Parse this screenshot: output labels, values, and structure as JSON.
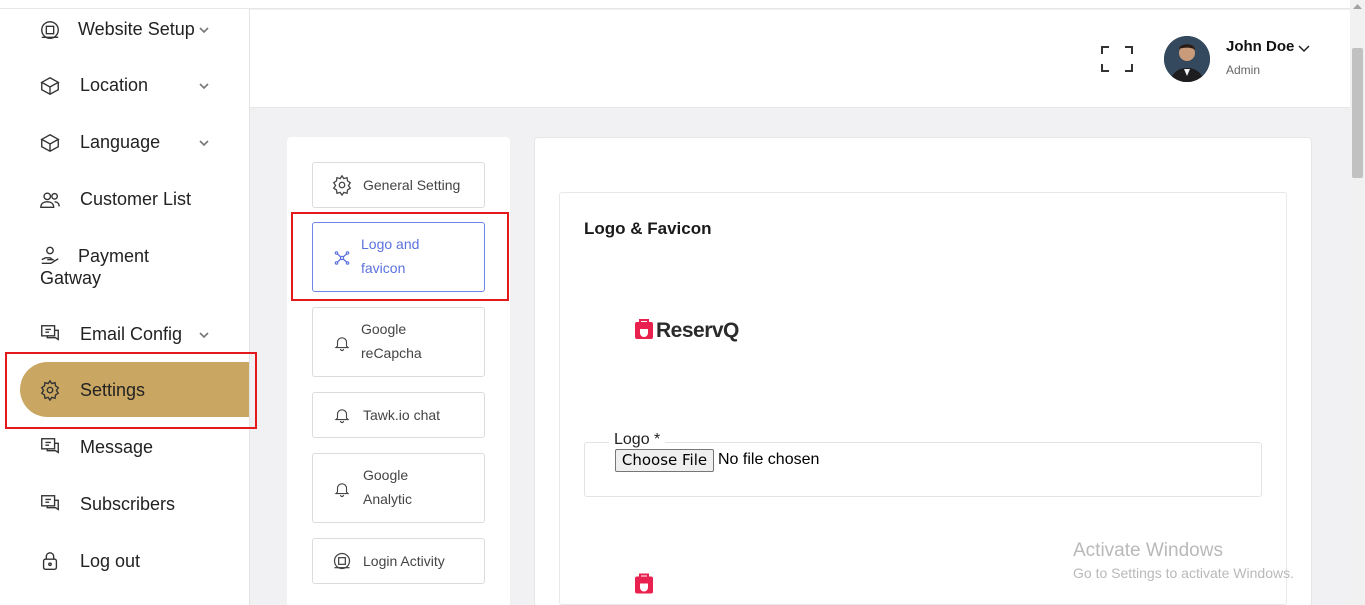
{
  "sidebar": {
    "items": [
      {
        "label": "Website Setup",
        "icon": "building-icon"
      },
      {
        "label": "Location",
        "icon": "cube-icon"
      },
      {
        "label": "Language",
        "icon": "cube-icon"
      },
      {
        "label": "Customer List",
        "icon": "users-icon"
      },
      {
        "label": "Payment",
        "label2": "Gatway",
        "icon": "hand-coin-icon"
      },
      {
        "label": "Email Config",
        "icon": "chat-icon"
      },
      {
        "label": "Settings",
        "icon": "gear-icon",
        "active": true
      },
      {
        "label": "Message",
        "icon": "chat-icon"
      },
      {
        "label": "Subscribers",
        "icon": "chat-icon"
      },
      {
        "label": "Log out",
        "icon": "lock-icon"
      }
    ],
    "active_color": "#c9a763"
  },
  "header": {
    "user_name": "John Doe",
    "user_role": "Admin"
  },
  "settings_tabs": [
    {
      "label": "General Setting",
      "icon": "gear-icon"
    },
    {
      "label": "Logo and",
      "label2": "favicon",
      "icon": "network-icon",
      "active": true
    },
    {
      "label": "Google",
      "label2": "reCapcha",
      "icon": "bell-icon"
    },
    {
      "label": "Tawk.io chat",
      "icon": "bell-icon"
    },
    {
      "label": "Google",
      "label2": "Analytic",
      "icon": "bell-icon"
    },
    {
      "label": "Login Activity",
      "icon": "building-icon"
    }
  ],
  "main": {
    "section_title": "Logo & Favicon",
    "brand_name": "ReservQ",
    "logo_field": {
      "legend": "Logo *",
      "button_label": "Choose File",
      "status": "No file chosen"
    }
  },
  "watermark": {
    "line1": "Activate Windows",
    "line2": "Go to Settings to activate Windows."
  },
  "colors": {
    "accent": "#c9a763",
    "highlight": "#e3191b",
    "tab_active": "#5b72de",
    "brand": "#e8214e"
  }
}
